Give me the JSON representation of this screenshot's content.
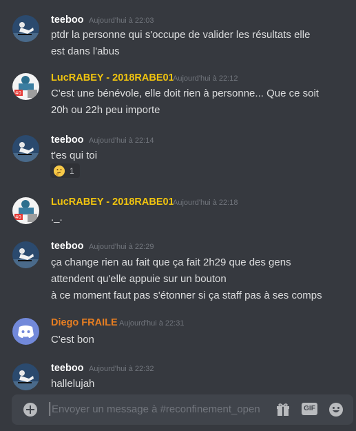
{
  "messages": [
    {
      "author": "teeboo",
      "author_color": "#ffffff",
      "avatar": "skater-avatar",
      "timestamp": "Aujourd'hui à 22:03",
      "lines": [
        "ptdr la personne qui s'occupe de valider les résultats elle",
        "est dans l'abus"
      ]
    },
    {
      "author": "LucRABEY - 2018RABE01",
      "author_color": "#f1c40f",
      "avatar": "photo-avatar",
      "timestamp": "Aujourd'hui à 22:12",
      "lines": [
        "C'est une bénévole, elle doit rien à personne... Que ce soit",
        "20h ou 22h peu importe"
      ]
    },
    {
      "author": "teeboo",
      "author_color": "#ffffff",
      "avatar": "skater-avatar",
      "timestamp": "Aujourd'hui à 22:14",
      "lines": [
        "t'es qui toi"
      ],
      "reaction": {
        "emoji": "thinking-face-icon",
        "count": "1"
      }
    },
    {
      "author": "LucRABEY - 2018RABE01",
      "author_color": "#f1c40f",
      "avatar": "photo-avatar",
      "timestamp": "Aujourd'hui à 22:18",
      "lines": [
        "._."
      ]
    },
    {
      "author": "teeboo",
      "author_color": "#ffffff",
      "avatar": "skater-avatar",
      "timestamp": "Aujourd'hui à 22:29",
      "lines": [
        "ça change rien au fait que ça fait 2h29 que des gens",
        "attendent qu'elle appuie sur un bouton",
        "à ce moment faut pas s'étonner si ça staff pas à ses comps"
      ]
    },
    {
      "author": "Diego FRAILE",
      "author_color": "#e67e22",
      "avatar": "discord-avatar",
      "timestamp": "Aujourd'hui à 22:31",
      "lines": [
        "C'est bon"
      ]
    },
    {
      "author": "teeboo",
      "author_color": "#ffffff",
      "avatar": "skater-avatar",
      "timestamp": "Aujourd'hui à 22:32",
      "lines": [
        "hallelujah"
      ]
    }
  ],
  "composer": {
    "placeholder": "Envoyer un message à #reconfinement_open",
    "gif_label": "GIF",
    "icons": [
      "plus-circle-icon",
      "gift-icon",
      "gif-icon",
      "emoji-icon"
    ]
  },
  "colors": {
    "background": "#36393f",
    "text": "#dcddde",
    "timestamp": "#72767d",
    "composer": "#40444b"
  }
}
